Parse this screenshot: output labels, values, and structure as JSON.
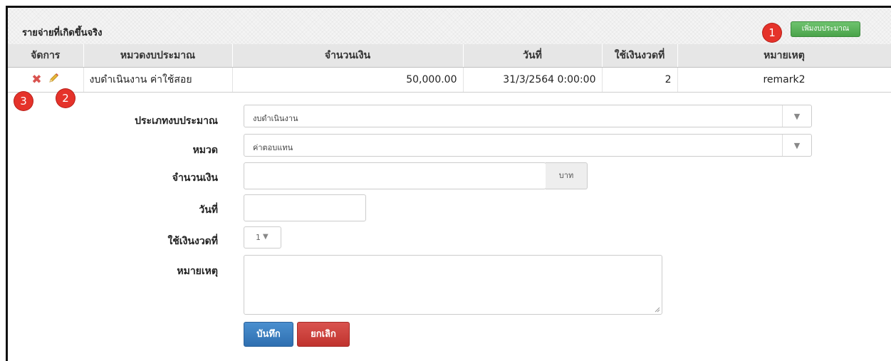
{
  "panel": {
    "title": "รายจ่ายที่เกิดขึ้นจริง",
    "add_button_label": "เพิ่มงบประมาณ"
  },
  "badges": [
    "1",
    "2",
    "3"
  ],
  "table": {
    "headers": [
      "จัดการ",
      "หมวดงบประมาณ",
      "จำนวนเงิน",
      "วันที่",
      "ใช้เงินงวดที่",
      "หมายเหตุ"
    ],
    "rows": [
      {
        "category": "งบดำเนินงาน ค่าใช้สอย",
        "amount": "50,000.00",
        "date": "31/3/2564 0:00:00",
        "installment": "2",
        "remark": "remark2"
      }
    ],
    "icons": {
      "delete": "x-icon",
      "edit": "pencil-icon"
    }
  },
  "form": {
    "budget_type_label": "ประเภทงบประมาณ",
    "budget_type_value": "งบดำเนินงาน",
    "category_label": "หมวด",
    "category_value": "ค่าตอบแทน",
    "amount_label": "จำนวนเงิน",
    "amount_value": "",
    "amount_unit": "บาท",
    "date_label": "วันที่",
    "date_value": "",
    "installment_label": "ใช้เงินงวดที่",
    "installment_value": "1",
    "remark_label": "หมายเหตุ",
    "remark_value": "",
    "save_label": "บันทึก",
    "cancel_label": "ยกเลิก"
  },
  "colors": {
    "add_button": "#4aa34a",
    "badge": "#e5322a",
    "save_button": "#2f6fb0",
    "cancel_button": "#c0332e",
    "delete_icon": "#d9534f"
  }
}
